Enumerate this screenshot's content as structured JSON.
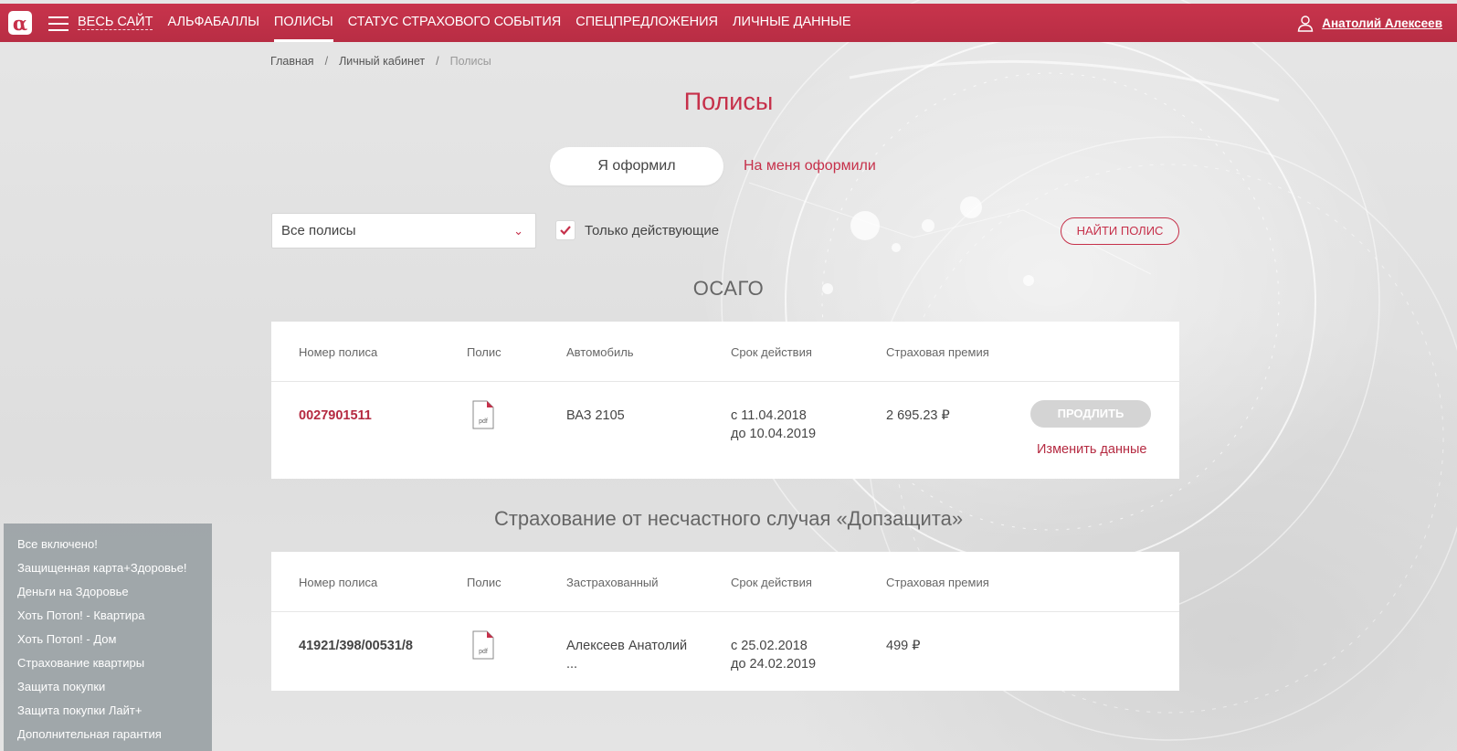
{
  "header": {
    "logo": "α",
    "nav": [
      {
        "label": "ВЕСЬ САЙТ"
      },
      {
        "label": "АЛЬФАБАЛЛЫ"
      },
      {
        "label": "ПОЛИСЫ"
      },
      {
        "label": "СТАТУС СТРАХОВОГО СОБЫТИЯ"
      },
      {
        "label": "СПЕЦПРЕДЛОЖЕНИЯ"
      },
      {
        "label": "ЛИЧНЫЕ ДАННЫЕ"
      }
    ],
    "active_nav": "ПОЛИСЫ",
    "user_name": "Анатолий Алексеев"
  },
  "breadcrumb": [
    "Главная",
    "Личный кабинет",
    "Полисы"
  ],
  "breadcrumb_separator": "/",
  "page_title": "Полисы",
  "tabs": {
    "own": "Я оформил",
    "other": "На меня оформили",
    "selected": "own"
  },
  "filters": {
    "select_value": "Все полисы",
    "checkbox_label": "Только действующие",
    "checkbox_checked": true,
    "find_button": "НАЙТИ ПОЛИС"
  },
  "sections": [
    {
      "title": "ОСАГО",
      "columns": [
        "Номер полиса",
        "Полис",
        "Автомобиль",
        "Срок действия",
        "Страховая премия"
      ],
      "rows": [
        {
          "number": "0027901511",
          "pdf": "pdf",
          "subject": "ВАЗ 2105",
          "period_from": "с 11.04.2018",
          "period_to": "до 10.04.2019",
          "premium": "2 695.23 ₽",
          "renew_button": "ПРОДЛИТЬ",
          "change_link": "Изменить данные"
        }
      ]
    },
    {
      "title": "Страхование от несчастного случая «Допзащита»",
      "columns": [
        "Номер полиса",
        "Полис",
        "Застрахованный",
        "Срок действия",
        "Страховая премия"
      ],
      "rows": [
        {
          "number": "41921/398/00531/8",
          "pdf": "pdf",
          "subject": "Алексеев Анатолий",
          "subject_more": "...",
          "period_from": "с 25.02.2018",
          "period_to": "до 24.02.2019",
          "premium": "499 ₽"
        }
      ]
    }
  ],
  "side_panel": [
    "Все включено!",
    "Защищенная карта+Здоровье!",
    "Деньги на Здоровье",
    "Хоть Потоп! - Квартира",
    "Хоть Потоп! - Дом",
    "Страхование квартиры",
    "Защита покупки",
    "Защита покупки Лайт+",
    "Дополнительная гарантия"
  ],
  "colors": {
    "brand": "#c6304a",
    "brand_dark": "#b52a41",
    "disabled_button": "#d4d4d4",
    "side_panel": "#969ea2"
  }
}
